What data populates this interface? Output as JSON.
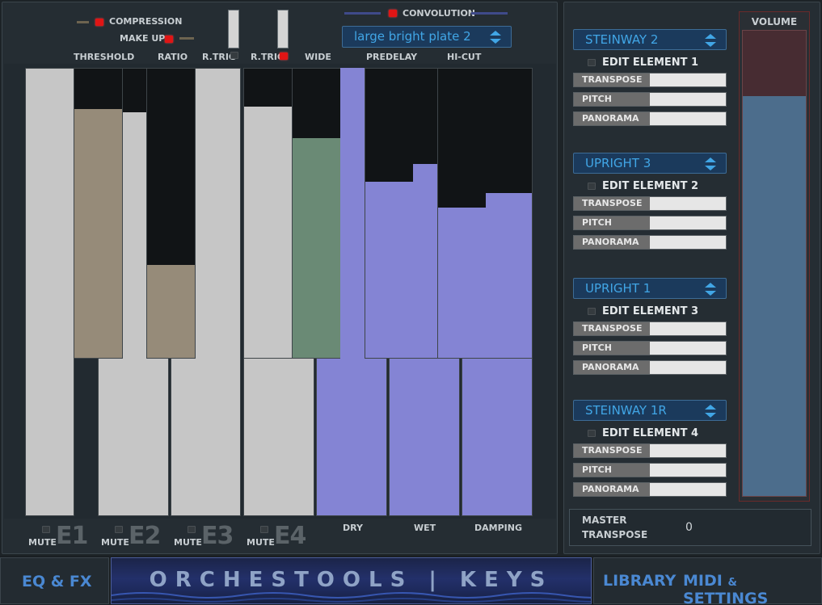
{
  "fx": {
    "compression": "COMPRESSION",
    "make_up": "MAKE UP",
    "convolution": "CONVOLUTION",
    "reverb_preset": "large bright plate 2",
    "col_threshold": "THRESHOLD",
    "col_ratio": "RATIO",
    "col_rtrig1": "R.TRIG",
    "col_rtrig2": "R.TRIG",
    "col_wide": "WIDE",
    "col_predelay": "PREDELAY",
    "col_hicut": "HI-CUT",
    "col_dry": "DRY",
    "col_wet": "WET",
    "col_damping": "DAMPING",
    "mute": "MUTE",
    "e1": "E1",
    "e2": "E2",
    "e3": "E3",
    "e4": "E4"
  },
  "fader_levels": {
    "threshold": 0.86,
    "ratio": 0.32,
    "e2_key": 0.85,
    "wide": 0.76,
    "wide_bg": 0.87,
    "dry": 1.0,
    "predelay": 0.61,
    "wet": 0.67,
    "hicut": 0.52,
    "damping": 0.57
  },
  "elements": [
    {
      "instrument": "STEINWAY 2",
      "edit": "EDIT ELEMENT 1",
      "transpose": "TRANSPOSE",
      "pitch": "PITCH",
      "panorama": "PANORAMA"
    },
    {
      "instrument": "UPRIGHT 3",
      "edit": "EDIT ELEMENT 2",
      "transpose": "TRANSPOSE",
      "pitch": "PITCH",
      "panorama": "PANORAMA"
    },
    {
      "instrument": "UPRIGHT 1",
      "edit": "EDIT ELEMENT 3",
      "transpose": "TRANSPOSE",
      "pitch": "PITCH",
      "panorama": "PANORAMA"
    },
    {
      "instrument": "STEINWAY 1R",
      "edit": "EDIT ELEMENT 4",
      "transpose": "TRANSPOSE",
      "pitch": "PITCH",
      "panorama": "PANORAMA"
    }
  ],
  "volume": {
    "label": "VOLUME",
    "level": 0.86
  },
  "master": {
    "label_line1": "MASTER",
    "label_line2": "TRANSPOSE",
    "value": "0"
  },
  "nav": {
    "eq_fx": "EQ & FX",
    "logo": "ORCHESTOOLS | KEYS",
    "library": "LIBRARY",
    "midi_settings": "MIDI",
    "amp": "&",
    "settings": "SETTINGS"
  },
  "colors": {
    "white_key": "#c6c6c6",
    "comp_fill": "#968b79",
    "wide_fill": "#6a8a75",
    "reverb_fill": "#8484d4",
    "accent": "#41a6e6",
    "led_on": "#e01515"
  }
}
